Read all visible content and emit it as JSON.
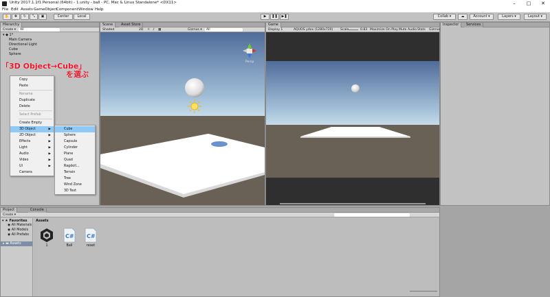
{
  "window": {
    "title": "Unity 2017.1.1f1 Personal (64bit) - 1.unity - ball - PC, Mac & Linux Standalone* <DX11>",
    "controls": [
      "–",
      "□",
      "✕"
    ]
  },
  "menu": [
    "File",
    "Edit",
    "Assets",
    "GameObject",
    "Component",
    "Window",
    "Help"
  ],
  "toolbar": {
    "pivot": "Center",
    "space": "Local",
    "play": "▶",
    "pause": "❚❚",
    "step": "▶❚",
    "collab": "Collab ▾",
    "account": "Account ▾",
    "layers": "Layers ▾",
    "layout": "Layout ▾"
  },
  "hierarchy": {
    "tab": "Hierarchy",
    "create": "Create ▾",
    "search": "All",
    "scene": "1*",
    "items": [
      "Main Camera",
      "Directional Light",
      "Cube",
      "Sphere"
    ]
  },
  "scene": {
    "tabs": [
      "Scene",
      "Asset Store"
    ],
    "shaded": "Shaded",
    "mode2d": "2D",
    "gizmos": "Gizmos ▾",
    "search": "All",
    "persp": "Persp"
  },
  "game": {
    "tab": "Game",
    "display": "Display 1",
    "resolution": "AQUOS ydxx (1280x720)",
    "scale_label": "Scale",
    "scale": "0.83",
    "buttons": [
      "Maximize On Play",
      "Mute Audio",
      "Stats",
      "Gizmos"
    ]
  },
  "inspector": {
    "tabs": [
      "Inspector",
      "Services"
    ]
  },
  "annotation": {
    "line1": "「3D Object→Cube」",
    "line2": "を選ぶ"
  },
  "context_menu": {
    "items": [
      "Copy",
      "Paste",
      "Rename",
      "Duplicate",
      "Delete",
      "Select Prefab",
      "Create Empty",
      "3D Object",
      "2D Object",
      "Effects",
      "Light",
      "Audio",
      "Video",
      "UI",
      "Camera"
    ],
    "disabled": [
      2,
      5
    ],
    "submenu_items": [
      7,
      8,
      9,
      10,
      11,
      12,
      13
    ],
    "separators_after": [
      1,
      4,
      5
    ],
    "selected": 7
  },
  "submenu": {
    "items": [
      "Cube",
      "Sphere",
      "Capsule",
      "Cylinder",
      "Plane",
      "Quad",
      "Ragdoll...",
      "Terrain",
      "Tree",
      "Wind Zone",
      "3D Text"
    ],
    "selected": 0
  },
  "project": {
    "tabs": [
      "Project",
      "Console"
    ],
    "create": "Create ▾",
    "favorites": "Favorites",
    "favorite_items": [
      "All Materials",
      "All Models",
      "All Prefabs"
    ],
    "assets_root": "Assets",
    "breadcrumb": "Assets",
    "assets": [
      {
        "name": "1",
        "kind": "unity"
      },
      {
        "name": "Ball",
        "kind": "script"
      },
      {
        "name": "reset",
        "kind": "script"
      }
    ]
  },
  "colors": {
    "sky_top": "#4f6c9a",
    "sky_horizon": "#c5dbe8",
    "ground": "#6a6156",
    "menu_selected": "#90c8f6",
    "annotation": "#e8162a",
    "panel": "#c2c2c2"
  }
}
